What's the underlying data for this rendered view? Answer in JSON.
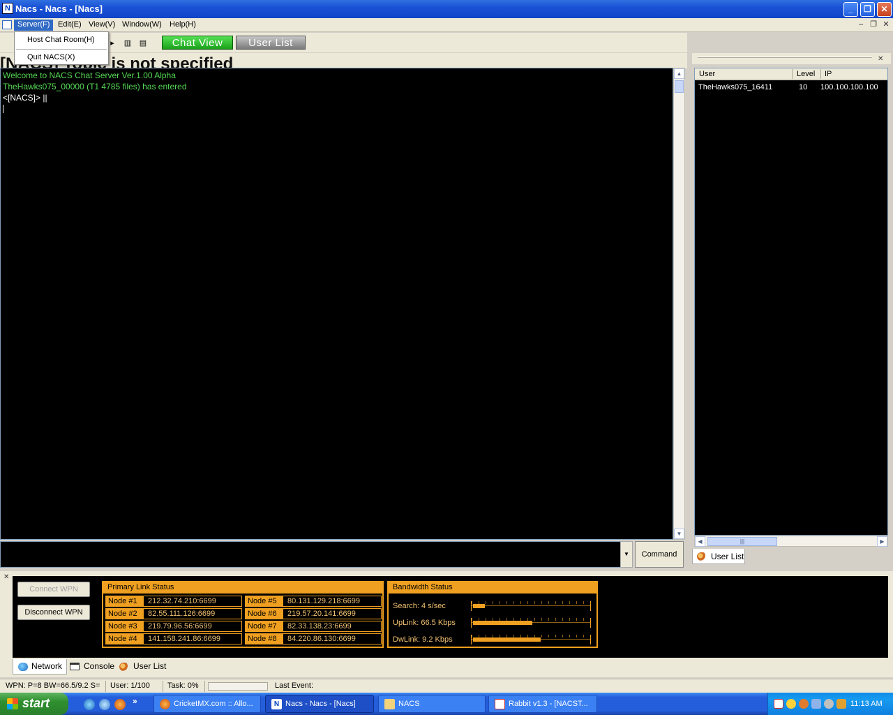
{
  "window": {
    "title": "Nacs - Nacs - [Nacs]",
    "minimize": "_",
    "maximize": "❐",
    "close": "✕"
  },
  "menu": {
    "items": [
      "Server(F)",
      "Edit(E)",
      "View(V)",
      "Window(W)",
      "Help(H)"
    ],
    "server_dropdown": [
      "Host Chat Room(H)",
      "Quit NACS(X)"
    ],
    "mdi_minimize": "–",
    "mdi_restore": "❐",
    "mdi_close": "✕"
  },
  "toolbar": {
    "chat_view": "Chat View",
    "user_list": "User List"
  },
  "topic": "[NACS] Topic is not specified",
  "chat": {
    "lines": [
      {
        "text": "Welcome to NACS Chat Server Ver.1.00 Alpha",
        "color": "#55d855"
      },
      {
        "text": "TheHawks075_00000 (T1 4785 files) has entered",
        "color": "#55d855"
      },
      {
        "text": "<[NACS]> ||",
        "color": "#ffffff"
      }
    ]
  },
  "command": {
    "input_value": "",
    "button": "Command"
  },
  "userlist": {
    "columns": [
      "User",
      "Level",
      "IP"
    ],
    "rows": [
      {
        "user": "TheHawks075_16411",
        "level": "10",
        "ip": "100.100.100.100"
      }
    ],
    "tab": "User List"
  },
  "network": {
    "connect_wpn": "Connect WPN",
    "disconnect_wpn": "Disconnect WPN",
    "primary_link_title": "Primary Link Status",
    "nodes": [
      {
        "label": "Node #1",
        "addr": "212.32.74.210:6699"
      },
      {
        "label": "Node #2",
        "addr": "82.55.111.126:6699"
      },
      {
        "label": "Node #3",
        "addr": "219.79.96.56:6699"
      },
      {
        "label": "Node #4",
        "addr": "141.158.241.86:6699"
      },
      {
        "label": "Node #5",
        "addr": "80.131.129.218:6699"
      },
      {
        "label": "Node #6",
        "addr": "219.57.20.141:6699"
      },
      {
        "label": "Node #7",
        "addr": "82.33.138.23:6699"
      },
      {
        "label": "Node #8",
        "addr": "84.220.86.130:6699"
      }
    ],
    "bandwidth_title": "Bandwidth Status",
    "bandwidth": [
      {
        "label": "Search:  4 s/sec",
        "fraction": 0.1
      },
      {
        "label": "UpLink: 66.5 Kbps",
        "fraction": 0.5
      },
      {
        "label": "DwLink:  9.2 Kbps",
        "fraction": 0.57
      }
    ],
    "accent": "#f0a020"
  },
  "bottom_tabs": [
    "Network",
    "Console",
    "User List"
  ],
  "status": {
    "wpn": "WPN:  P=8 BW=66.5/9.2 S=",
    "user": "User:  1/100",
    "task": "Task:  0%",
    "last_event": "Last Event:"
  },
  "taskbar": {
    "start": "start",
    "tasks": [
      "CricketMX.com :: Allo...",
      "Nacs - Nacs - [Nacs]",
      "NACS",
      "Rabbit v1.3 - [NACST..."
    ],
    "clock": "11:13 AM"
  }
}
